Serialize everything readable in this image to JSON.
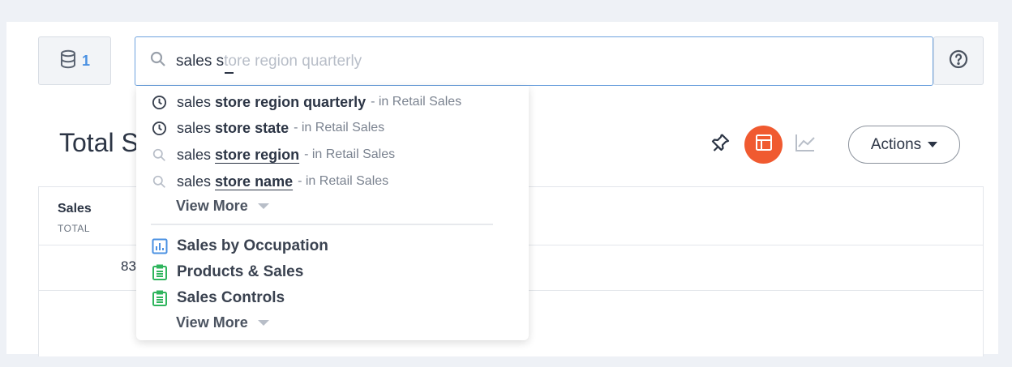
{
  "header": {
    "source_count": "1",
    "search": {
      "typed": "sales s",
      "completion": "tore region quarterly"
    }
  },
  "answer": {
    "title": "Total S"
  },
  "toolbar": {
    "actions_label": "Actions"
  },
  "table": {
    "header": {
      "name": "Sales",
      "sub": "TOTAL"
    },
    "rows": [
      {
        "value": "83"
      }
    ]
  },
  "dropdown": {
    "suggestions": [
      {
        "prefix": "sales ",
        "match": "store region quarterly",
        "source": "- in Retail Sales",
        "icon": "clock-icon"
      },
      {
        "prefix": "sales ",
        "match": "store state",
        "source": "- in Retail Sales",
        "icon": "clock-icon"
      },
      {
        "prefix": "sales ",
        "match": "store region",
        "source": "- in Retail Sales",
        "icon": "search-icon"
      },
      {
        "prefix": "sales ",
        "match": "store name",
        "source": "- in Retail Sales",
        "icon": "search-icon"
      }
    ],
    "view_more_1": "View More",
    "objects": [
      {
        "label": "Sales by Occupation",
        "icon": "bar-chart-icon",
        "color": "#4a90e2"
      },
      {
        "label": "Products & Sales",
        "icon": "clipboard-icon",
        "color": "#2fb55d"
      },
      {
        "label": "Sales Controls",
        "icon": "clipboard-icon",
        "color": "#2fb55d"
      }
    ],
    "view_more_2": "View More"
  },
  "colors": {
    "accent": "#f05a30",
    "link": "#4a90e2",
    "green": "#2fb55d"
  }
}
